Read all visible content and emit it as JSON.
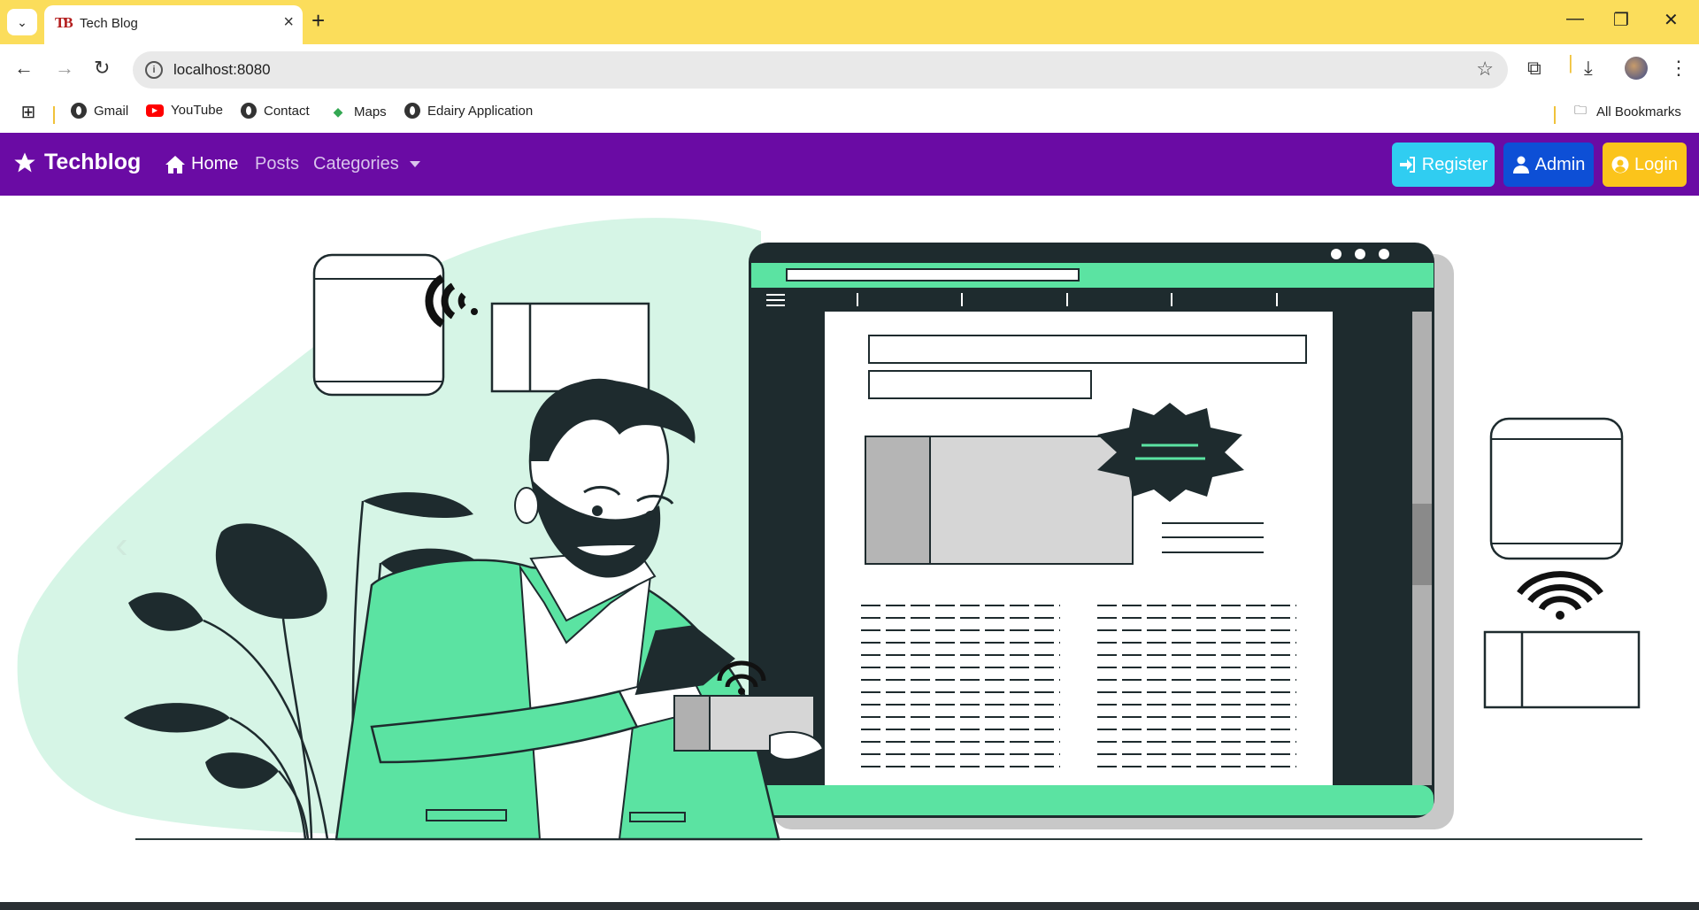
{
  "browser": {
    "tab_title": "Tech Blog",
    "tab_favicon": "TB",
    "url": "localhost:8080",
    "bookmarks": [
      {
        "label": "Gmail",
        "icon": "globe-icon"
      },
      {
        "label": "YouTube",
        "icon": "youtube-icon"
      },
      {
        "label": "Contact",
        "icon": "globe-icon"
      },
      {
        "label": "Maps",
        "icon": "maps-icon"
      },
      {
        "label": "Edairy Application",
        "icon": "globe-icon"
      }
    ],
    "all_bookmarks": "All Bookmarks"
  },
  "site": {
    "brand": "Techblog",
    "nav": {
      "home": "Home",
      "posts": "Posts",
      "categories": "Categories"
    },
    "buttons": {
      "register": "Register",
      "admin": "Admin",
      "login": "Login"
    },
    "colors": {
      "navbar": "#6a0ba4",
      "register": "#30cdf1",
      "admin": "#0d4fd6",
      "login": "#fbc41b",
      "illustration_accent": "#5be3a2"
    }
  }
}
